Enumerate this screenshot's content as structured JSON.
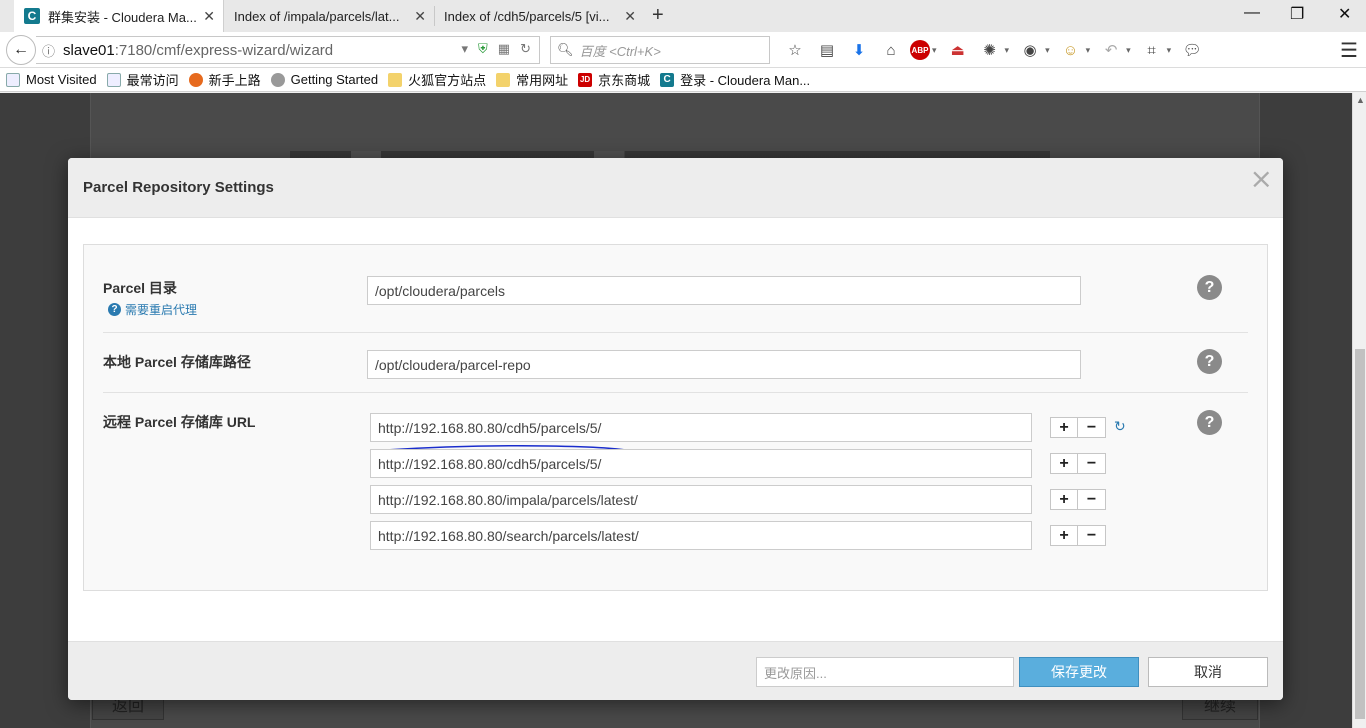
{
  "browser": {
    "tabs": [
      {
        "title": "群集安装 - Cloudera Ma...",
        "active": true
      },
      {
        "title": "Index of /impala/parcels/lat...",
        "active": false
      },
      {
        "title": "Index of /cdh5/parcels/5 [vi...",
        "active": false
      }
    ],
    "url_host": "slave01",
    "url_path": ":7180/cmf/express-wizard/wizard",
    "search_placeholder": "百度 <Ctrl+K>",
    "bookmarks": [
      {
        "label": "Most Visited",
        "icon": "doc-icon"
      },
      {
        "label": "最常访问",
        "icon": "doc-icon"
      },
      {
        "label": "新手上路",
        "icon": "firefox-icon"
      },
      {
        "label": "Getting Started",
        "icon": "globe-icon"
      },
      {
        "label": "火狐官方站点",
        "icon": "folder-icon"
      },
      {
        "label": "常用网址",
        "icon": "folder-icon"
      },
      {
        "label": "京东商城",
        "icon": "jd-icon",
        "badge": "JD"
      },
      {
        "label": "登录 - Cloudera Man...",
        "icon": "cloudera-icon",
        "badge": "C"
      }
    ]
  },
  "page": {
    "back_label": "返回",
    "next_label": "继续"
  },
  "modal": {
    "title": "Parcel Repository Settings",
    "parcel_dir": {
      "label": "Parcel 目录",
      "note": "需要重启代理",
      "value": "/opt/cloudera/parcels"
    },
    "local_repo": {
      "label": "本地 Parcel 存储库路径",
      "value": "/opt/cloudera/parcel-repo"
    },
    "remote_repo": {
      "label": "远程 Parcel 存储库 URL",
      "urls": [
        "http://192.168.80.80/cdh5/parcels/5/",
        "http://192.168.80.80/cdh5/parcels/5/",
        "http://192.168.80.80/impala/parcels/latest/",
        "http://192.168.80.80/search/parcels/latest/"
      ]
    },
    "footer": {
      "reason_placeholder": "更改原因...",
      "save_label": "保存更改",
      "cancel_label": "取消"
    }
  },
  "colors": {
    "primary_button": "#5aaedd",
    "link_blue": "#2a7ab0",
    "annotation_stroke": "#1a2dcc"
  }
}
